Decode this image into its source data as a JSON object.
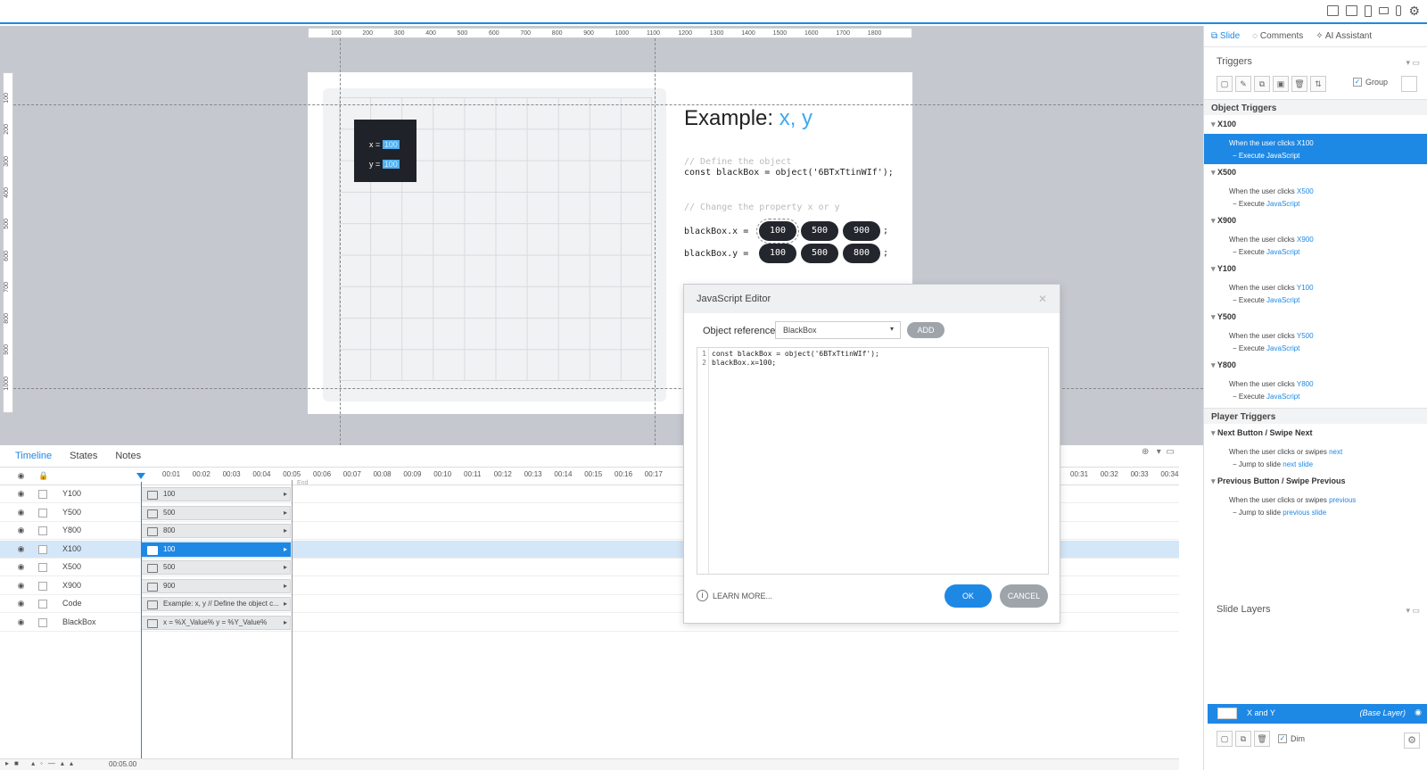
{
  "stage": {
    "ruler_h": [
      "100",
      "200",
      "300",
      "400",
      "500",
      "600",
      "700",
      "800",
      "900",
      "1000",
      "1100",
      "1200",
      "1300",
      "1400",
      "1500",
      "1600",
      "1700",
      "1800"
    ],
    "ruler_v": [
      "100",
      "200",
      "300",
      "400",
      "500",
      "600",
      "700",
      "800",
      "900",
      "1000"
    ],
    "box_x_label": "x =",
    "box_x_value": "100",
    "box_y_label": "y =",
    "box_y_value": "100",
    "title_prefix": "Example:",
    "title_vars": "x, y",
    "comment1": "// Define the object",
    "code1": "const blackBox = object('6BTxTtinWIf');",
    "comment2": "// Change the property x or y",
    "x_line": "blackBox.x =",
    "y_line": "blackBox.y =",
    "x_buttons": [
      "100",
      "500",
      "900"
    ],
    "y_buttons": [
      "100",
      "500",
      "800"
    ],
    "semicolon": ";"
  },
  "timeline": {
    "tabs": [
      "Timeline",
      "States",
      "Notes"
    ],
    "ticks": [
      "00:01",
      "00:02",
      "00:03",
      "00:04",
      "00:05",
      "00:06",
      "00:07",
      "00:08",
      "00:09",
      "00:10",
      "00:11",
      "00:12",
      "00:13",
      "00:14",
      "00:15",
      "00:16",
      "00:17",
      "00:31",
      "00:32",
      "00:33",
      "00:34"
    ],
    "end_label": "End",
    "rows": [
      {
        "name": "Y100",
        "bar": "100"
      },
      {
        "name": "Y500",
        "bar": "500"
      },
      {
        "name": "Y800",
        "bar": "800"
      },
      {
        "name": "X100",
        "bar": "100"
      },
      {
        "name": "X500",
        "bar": "500"
      },
      {
        "name": "X900",
        "bar": "900"
      },
      {
        "name": "Code",
        "bar": "Example: x, y // Define the object c..."
      },
      {
        "name": "BlackBox",
        "bar": "x = %X_Value% y = %Y_Value%"
      }
    ],
    "duration": "00:05.00"
  },
  "dialog": {
    "title": "JavaScript Editor",
    "ref_label": "Object reference",
    "ref_value": "BlackBox",
    "add_label": "ADD",
    "line_numbers": "1\n2",
    "code": "const blackBox = object('6BTxTtinWIf');\nblackBox.x=100;",
    "learn_more": "LEARN MORE...",
    "ok": "OK",
    "cancel": "CANCEL"
  },
  "panel": {
    "tabs": [
      "Slide",
      "Comments",
      "AI Assistant"
    ],
    "triggers_title": "Triggers",
    "group_label": "Group",
    "object_triggers": "Object Triggers",
    "player_triggers": "Player Triggers",
    "object_groups": [
      {
        "name": "X100",
        "pre": "When the user clicks",
        "obj": "X100",
        "action": "Execute",
        "target": "JavaScript"
      },
      {
        "name": "X500",
        "pre": "When the user clicks",
        "obj": "X500",
        "action": "Execute",
        "target": "JavaScript"
      },
      {
        "name": "X900",
        "pre": "When the user clicks",
        "obj": "X900",
        "action": "Execute",
        "target": "JavaScript"
      },
      {
        "name": "Y100",
        "pre": "When the user clicks",
        "obj": "Y100",
        "action": "Execute",
        "target": "JavaScript"
      },
      {
        "name": "Y500",
        "pre": "When the user clicks",
        "obj": "Y500",
        "action": "Execute",
        "target": "JavaScript"
      },
      {
        "name": "Y800",
        "pre": "When the user clicks",
        "obj": "Y800",
        "action": "Execute",
        "target": "JavaScript"
      }
    ],
    "player_groups": [
      {
        "name": "Next Button / Swipe Next",
        "pre": "When the user clicks or swipes",
        "obj": "next",
        "action": "Jump to slide",
        "target": "next slide"
      },
      {
        "name": "Previous Button / Swipe Previous",
        "pre": "When the user clicks or swipes",
        "obj": "previous",
        "action": "Jump to slide",
        "target": "previous slide"
      }
    ],
    "layers_title": "Slide Layers",
    "layer_name": "X and Y",
    "layer_base": "(Base Layer)",
    "dim_label": "Dim"
  },
  "colors": {
    "accent": "#1e88e5",
    "stage": "#c5c9cf",
    "dark": "#23272d"
  }
}
